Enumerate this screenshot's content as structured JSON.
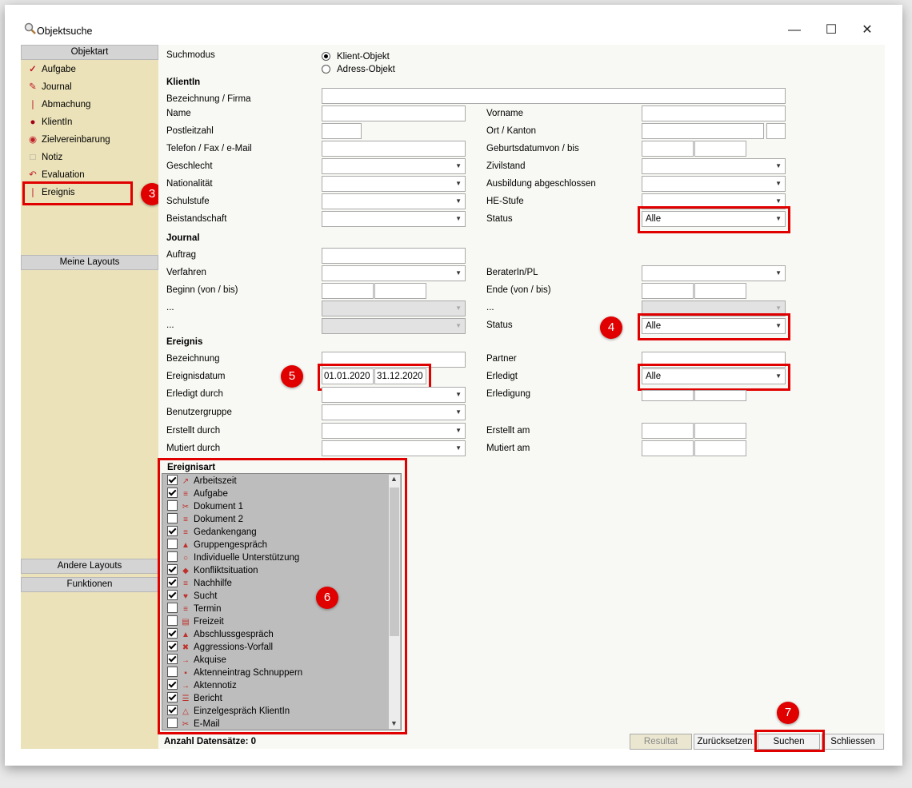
{
  "window": {
    "title": "Objektsuche",
    "minimize_icon": "minimize-icon",
    "maximize_icon": "maximize-icon",
    "close_icon": "close-icon"
  },
  "sidebar": {
    "header_objektart": "Objektart",
    "items": [
      {
        "label": "Aufgabe",
        "icon": "checkmark-icon"
      },
      {
        "label": "Journal",
        "icon": "pencil-icon"
      },
      {
        "label": "Abmachung",
        "icon": "pin-icon"
      },
      {
        "label": "KlientIn",
        "icon": "seal-icon"
      },
      {
        "label": "Zielvereinbarung",
        "icon": "target-icon"
      },
      {
        "label": "Notiz",
        "icon": "note-icon"
      },
      {
        "label": "Evaluation",
        "icon": "undo-arrow-icon"
      },
      {
        "label": "Ereignis",
        "icon": "event-icon"
      }
    ],
    "meine_layouts": "Meine Layouts",
    "andere_layouts": "Andere Layouts",
    "funktionen": "Funktionen"
  },
  "form": {
    "suchmodus": {
      "label": "Suchmodus",
      "options": [
        "Klient-Objekt",
        "Adress-Objekt"
      ],
      "selected": "Klient-Objekt"
    },
    "klientin": {
      "heading": "KlientIn",
      "bezeichnung": "Bezeichnung / Firma",
      "name": "Name",
      "vorname": "Vorname",
      "plz": "Postleitzahl",
      "ort": "Ort / Kanton",
      "telefon": "Telefon / Fax / e-Mail",
      "geburtsdatum": "Geburtsdatumvon / bis",
      "geschlecht": "Geschlecht",
      "zivilstand": "Zivilstand",
      "nationalitaet": "Nationalität",
      "ausbildung": "Ausbildung abgeschlossen",
      "schulstufe": "Schulstufe",
      "he_stufe": "HE-Stufe",
      "beistandschaft": "Beistandschaft",
      "status": "Status",
      "status_value": "Alle"
    },
    "journal": {
      "heading": "Journal",
      "auftrag": "Auftrag",
      "verfahren": "Verfahren",
      "berater": "BeraterIn/PL",
      "beginn": "Beginn (von / bis)",
      "ende": "Ende (von / bis)",
      "dots1": "...",
      "dots2": "...",
      "dots3": "...",
      "status": "Status",
      "status_value": "Alle"
    },
    "ereignis": {
      "heading": "Ereignis",
      "bezeichnung": "Bezeichnung",
      "partner": "Partner",
      "ereignisdatum": "Ereignisdatum",
      "datum_von": "01.01.2020",
      "datum_bis": "31.12.2020",
      "erledigt": "Erledigt",
      "erledigt_value": "Alle",
      "erledigt_durch": "Erledigt durch",
      "erledigung": "Erledigung",
      "benutzergruppe": "Benutzergruppe",
      "erstellt_durch": "Erstellt durch",
      "erstellt_am": "Erstellt am",
      "mutiert_durch": "Mutiert durch",
      "mutiert_am": "Mutiert am"
    }
  },
  "ereignisart": {
    "heading": "Ereignisart",
    "items": [
      {
        "label": "Arbeitszeit",
        "checked": true,
        "icon": "clock-doc-icon"
      },
      {
        "label": "Aufgabe",
        "checked": true,
        "icon": "form-icon"
      },
      {
        "label": "Dokument 1",
        "checked": false,
        "icon": "document-icon"
      },
      {
        "label": "Dokument 2",
        "checked": false,
        "icon": "form-icon"
      },
      {
        "label": "Gedankengang",
        "checked": true,
        "icon": "form-icon"
      },
      {
        "label": "Gruppengespräch",
        "checked": false,
        "icon": "person-icon"
      },
      {
        "label": "Individuelle Unterstützung",
        "checked": false,
        "icon": "circle-icon"
      },
      {
        "label": "Konfliktsituation",
        "checked": true,
        "icon": "pencil-icon"
      },
      {
        "label": "Nachhilfe",
        "checked": true,
        "icon": "form-icon"
      },
      {
        "label": "Sucht",
        "checked": true,
        "icon": "heart-icon"
      },
      {
        "label": "Termin",
        "checked": false,
        "icon": "form-icon"
      },
      {
        "label": "Freizeit",
        "checked": false,
        "icon": "news-icon"
      },
      {
        "label": "Abschlussgespräch",
        "checked": true,
        "icon": "person-icon"
      },
      {
        "label": "Aggressions-Vorfall",
        "checked": true,
        "icon": "x-icon"
      },
      {
        "label": "Akquise",
        "checked": true,
        "icon": "arrow-doc-icon"
      },
      {
        "label": "Aktenneintrag Schnuppern",
        "checked": false,
        "icon": "doc-mark-icon"
      },
      {
        "label": "Aktennotiz",
        "checked": true,
        "icon": "arrow-doc-icon"
      },
      {
        "label": "Bericht",
        "checked": true,
        "icon": "report-icon"
      },
      {
        "label": "Einzelgespräch KlientIn",
        "checked": true,
        "icon": "person-outline-icon"
      },
      {
        "label": "E-Mail",
        "checked": false,
        "icon": "document-icon"
      }
    ]
  },
  "footer": {
    "count_label": "Anzahl Datensätze: 0",
    "resultat": "Resultat",
    "zuruecksetzen": "Zurücksetzen",
    "suchen": "Suchen",
    "schliessen": "Schliessen"
  },
  "annotations": [
    "3",
    "4",
    "5",
    "6",
    "7"
  ],
  "colors": {
    "highlight": "#e00000",
    "sidebar_bg": "#ebe2b9",
    "form_bg": "#f8f9f4"
  }
}
